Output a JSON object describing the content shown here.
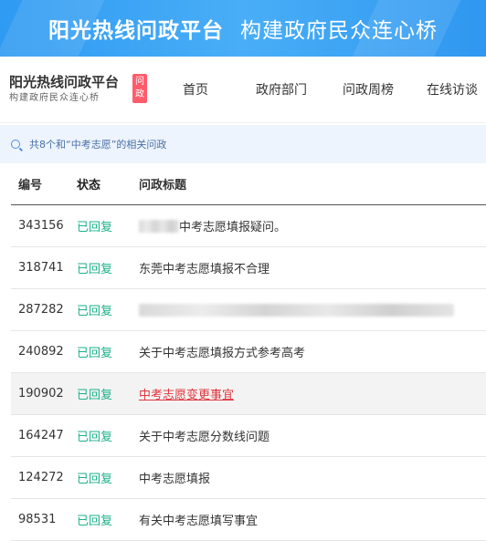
{
  "banner": {
    "title": "阳光热线问政平台",
    "slogan": "构建政府民众连心桥"
  },
  "logo": {
    "line1": "阳光热线问政平台",
    "line2": "构建政府民众连心桥",
    "badge": "问政"
  },
  "nav": {
    "items": [
      "首页",
      "政府部门",
      "问政周榜",
      "在线访谈"
    ]
  },
  "notice": {
    "text": "共8个和“中考志愿”的相关问政"
  },
  "table": {
    "headers": [
      "编号",
      "状态",
      "问政标题"
    ],
    "rows": [
      {
        "id": "343156",
        "status": "已回复",
        "title": "中考志愿填报疑问。"
      },
      {
        "id": "318741",
        "status": "已回复",
        "title": "东莞中考志愿填报不合理"
      },
      {
        "id": "287282",
        "status": "已回复",
        "title": ""
      },
      {
        "id": "240892",
        "status": "已回复",
        "title": "关于中考志愿填报方式参考高考"
      },
      {
        "id": "190902",
        "status": "已回复",
        "title": "中考志愿变更事宜"
      },
      {
        "id": "164247",
        "status": "已回复",
        "title": "关于中考志愿分数线问题"
      },
      {
        "id": "124272",
        "status": "已回复",
        "title": "中考志愿填报"
      },
      {
        "id": "98531",
        "status": "已回复",
        "title": "有关中考志愿填写事宜"
      }
    ]
  },
  "colors": {
    "banner": "#2f9af2",
    "status": "#1bb28a",
    "link": "#e0343c",
    "badge": "#ff5b6b"
  }
}
